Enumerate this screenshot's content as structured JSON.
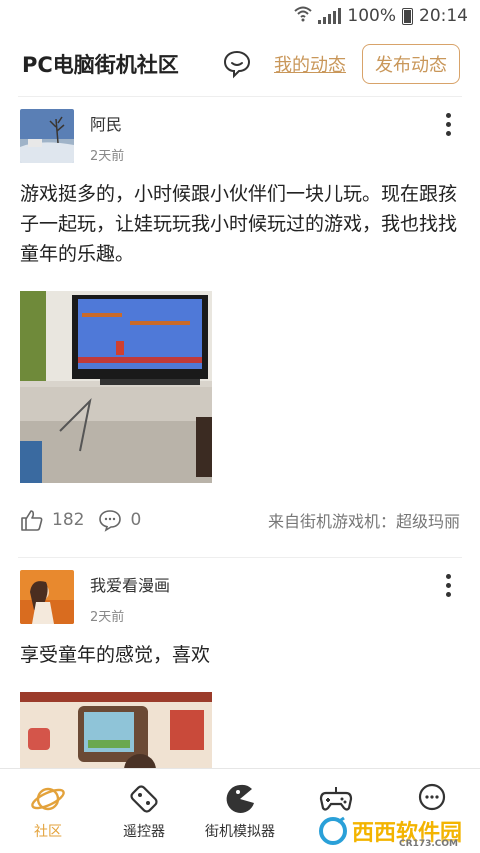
{
  "status": {
    "battery": "100%",
    "time": "20:14"
  },
  "header": {
    "title": "PC电脑街机社区",
    "my_posts": "我的动态",
    "publish": "发布动态"
  },
  "posts": [
    {
      "author": "阿民",
      "time": "2天前",
      "text": "游戏挺多的，小时候跟小伙伴们一块儿玩。现在跟孩子一起玩，让娃玩玩我小时候玩过的游戏，我也找找童年的乐趣。",
      "likes": "182",
      "comments": "0",
      "source": "来自街机游戏机：超级玛丽"
    },
    {
      "author": "我爱看漫画",
      "time": "2天前",
      "text": "享受童年的感觉，喜欢"
    }
  ],
  "nav": [
    {
      "label": "社区",
      "icon": "planet-icon"
    },
    {
      "label": "遥控器",
      "icon": "remote-icon"
    },
    {
      "label": "街机模拟器",
      "icon": "pacman-icon"
    },
    {
      "label": "",
      "icon": "gamepad-icon"
    },
    {
      "label": "",
      "icon": "chat-icon"
    }
  ],
  "watermark": {
    "text": "西西软件园",
    "sub": "CR173.COM"
  },
  "colors": {
    "accent": "#c9975a",
    "active_tab": "#e3a23b"
  }
}
